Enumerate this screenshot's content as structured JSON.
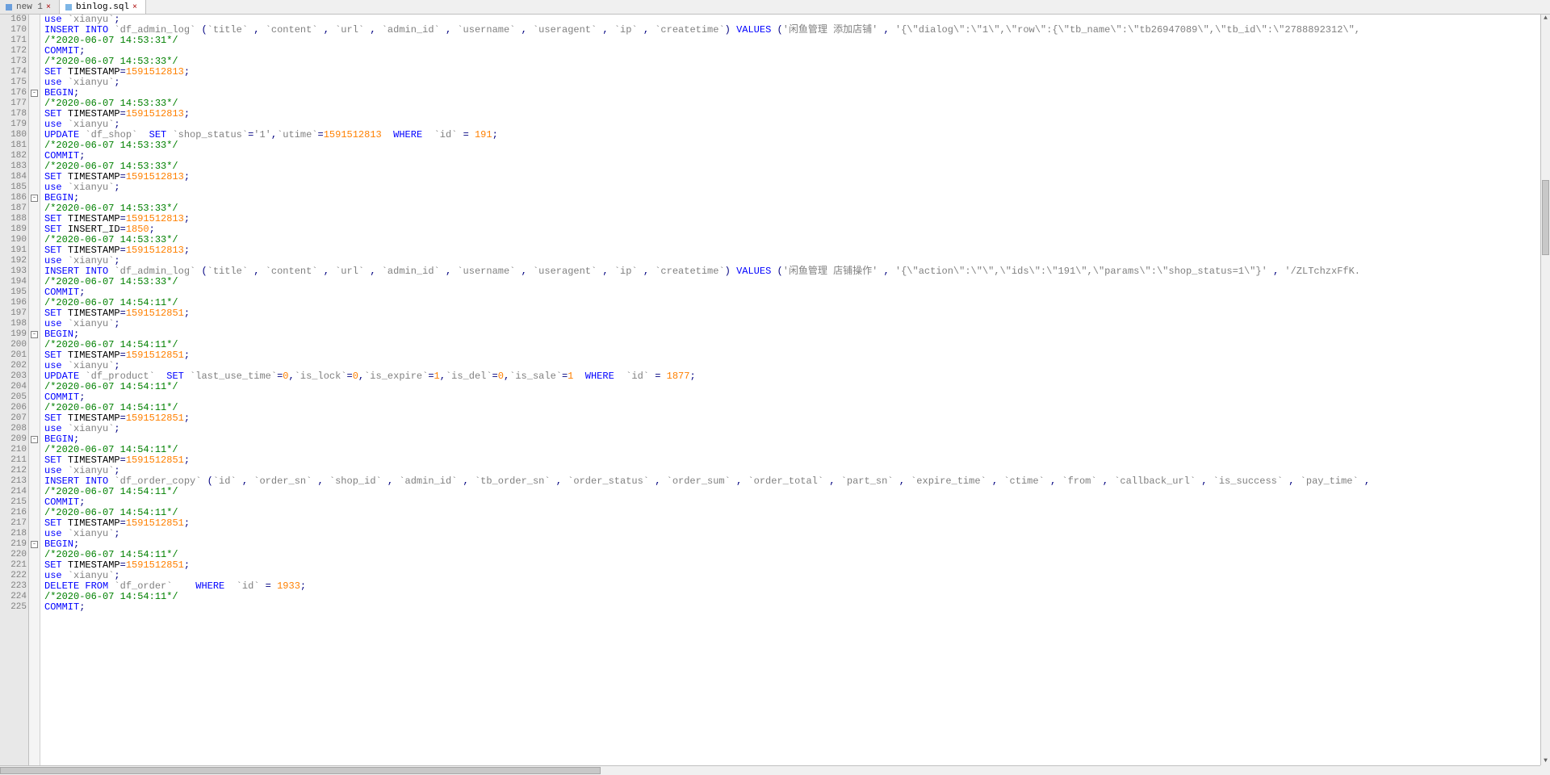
{
  "tabs": [
    {
      "label": "new 1",
      "active": false,
      "icon": "new"
    },
    {
      "label": "binlog.sql",
      "active": true,
      "icon": "sql"
    }
  ],
  "first_line": 169,
  "fold_lines": [
    176,
    186,
    199,
    209,
    219
  ],
  "scroll": {
    "v_thumb_top_pct": 22,
    "v_thumb_h_pct": 10,
    "h_thumb_left_pct": 0,
    "h_thumb_w_pct": 39
  },
  "lines": [
    [
      [
        "kw",
        "use "
      ],
      [
        "id",
        "`xianyu`"
      ],
      [
        "pun",
        ";"
      ]
    ],
    [
      [
        "kw",
        "INSERT INTO "
      ],
      [
        "id",
        "`df_admin_log`"
      ],
      [
        "pun",
        " ("
      ],
      [
        "id",
        "`title`"
      ],
      [
        "pun",
        " , "
      ],
      [
        "id",
        "`content`"
      ],
      [
        "pun",
        " , "
      ],
      [
        "id",
        "`url`"
      ],
      [
        "pun",
        " , "
      ],
      [
        "id",
        "`admin_id`"
      ],
      [
        "pun",
        " , "
      ],
      [
        "id",
        "`username`"
      ],
      [
        "pun",
        " , "
      ],
      [
        "id",
        "`useragent`"
      ],
      [
        "pun",
        " , "
      ],
      [
        "id",
        "`ip`"
      ],
      [
        "pun",
        " , "
      ],
      [
        "id",
        "`createtime`"
      ],
      [
        "pun",
        ") "
      ],
      [
        "kw",
        "VALUES"
      ],
      [
        "pun",
        " ("
      ],
      [
        "str",
        "'闲鱼管理 添加店铺'"
      ],
      [
        "pun",
        " , "
      ],
      [
        "str",
        "'{\\\"dialog\\\":\\\"1\\\",\\\"row\\\":{\\\"tb_name\\\":\\\"tb26947089\\\",\\\"tb_id\\\":\\\"2788892312\\\","
      ]
    ],
    [
      [
        "cmt",
        "/*2020-06-07 14:53:31*/"
      ]
    ],
    [
      [
        "kw",
        "COMMIT"
      ],
      [
        "pun",
        ";"
      ]
    ],
    [
      [
        "cmt",
        "/*2020-06-07 14:53:33*/"
      ]
    ],
    [
      [
        "kw",
        "SET "
      ],
      [
        "",
        "TIMESTAMP"
      ],
      [
        "pun",
        "="
      ],
      [
        "num",
        "1591512813"
      ],
      [
        "pun",
        ";"
      ]
    ],
    [
      [
        "kw",
        "use "
      ],
      [
        "id",
        "`xianyu`"
      ],
      [
        "pun",
        ";"
      ]
    ],
    [
      [
        "kw",
        "BEGIN"
      ],
      [
        "pun",
        ";"
      ]
    ],
    [
      [
        "cmt",
        "/*2020-06-07 14:53:33*/"
      ]
    ],
    [
      [
        "kw",
        "SET "
      ],
      [
        "",
        "TIMESTAMP"
      ],
      [
        "pun",
        "="
      ],
      [
        "num",
        "1591512813"
      ],
      [
        "pun",
        ";"
      ]
    ],
    [
      [
        "kw",
        "use "
      ],
      [
        "id",
        "`xianyu`"
      ],
      [
        "pun",
        ";"
      ]
    ],
    [
      [
        "kw",
        "UPDATE "
      ],
      [
        "id",
        "`df_shop`"
      ],
      [
        "",
        "  "
      ],
      [
        "kw",
        "SET"
      ],
      [
        "",
        ""
      ],
      [
        "id",
        " `shop_status`"
      ],
      [
        "pun",
        "="
      ],
      [
        "str",
        "'1'"
      ],
      [
        "pun",
        ","
      ],
      [
        "id",
        "`utime`"
      ],
      [
        "pun",
        "="
      ],
      [
        "num",
        "1591512813"
      ],
      [
        "",
        "  "
      ],
      [
        "kw",
        "WHERE"
      ],
      [
        "",
        "  "
      ],
      [
        "id",
        "`id`"
      ],
      [
        "pun",
        " = "
      ],
      [
        "num",
        "191"
      ],
      [
        "pun",
        ";"
      ]
    ],
    [
      [
        "cmt",
        "/*2020-06-07 14:53:33*/"
      ]
    ],
    [
      [
        "kw",
        "COMMIT"
      ],
      [
        "pun",
        ";"
      ]
    ],
    [
      [
        "cmt",
        "/*2020-06-07 14:53:33*/"
      ]
    ],
    [
      [
        "kw",
        "SET "
      ],
      [
        "",
        "TIMESTAMP"
      ],
      [
        "pun",
        "="
      ],
      [
        "num",
        "1591512813"
      ],
      [
        "pun",
        ";"
      ]
    ],
    [
      [
        "kw",
        "use "
      ],
      [
        "id",
        "`xianyu`"
      ],
      [
        "pun",
        ";"
      ]
    ],
    [
      [
        "kw",
        "BEGIN"
      ],
      [
        "pun",
        ";"
      ]
    ],
    [
      [
        "cmt",
        "/*2020-06-07 14:53:33*/"
      ]
    ],
    [
      [
        "kw",
        "SET "
      ],
      [
        "",
        "TIMESTAMP"
      ],
      [
        "pun",
        "="
      ],
      [
        "num",
        "1591512813"
      ],
      [
        "pun",
        ";"
      ]
    ],
    [
      [
        "kw",
        "SET "
      ],
      [
        "",
        "INSERT_ID"
      ],
      [
        "pun",
        "="
      ],
      [
        "num",
        "1850"
      ],
      [
        "pun",
        ";"
      ]
    ],
    [
      [
        "cmt",
        "/*2020-06-07 14:53:33*/"
      ]
    ],
    [
      [
        "kw",
        "SET "
      ],
      [
        "",
        "TIMESTAMP"
      ],
      [
        "pun",
        "="
      ],
      [
        "num",
        "1591512813"
      ],
      [
        "pun",
        ";"
      ]
    ],
    [
      [
        "kw",
        "use "
      ],
      [
        "id",
        "`xianyu`"
      ],
      [
        "pun",
        ";"
      ]
    ],
    [
      [
        "kw",
        "INSERT INTO "
      ],
      [
        "id",
        "`df_admin_log`"
      ],
      [
        "pun",
        " ("
      ],
      [
        "id",
        "`title`"
      ],
      [
        "pun",
        " , "
      ],
      [
        "id",
        "`content`"
      ],
      [
        "pun",
        " , "
      ],
      [
        "id",
        "`url`"
      ],
      [
        "pun",
        " , "
      ],
      [
        "id",
        "`admin_id`"
      ],
      [
        "pun",
        " , "
      ],
      [
        "id",
        "`username`"
      ],
      [
        "pun",
        " , "
      ],
      [
        "id",
        "`useragent`"
      ],
      [
        "pun",
        " , "
      ],
      [
        "id",
        "`ip`"
      ],
      [
        "pun",
        " , "
      ],
      [
        "id",
        "`createtime`"
      ],
      [
        "pun",
        ") "
      ],
      [
        "kw",
        "VALUES"
      ],
      [
        "pun",
        " ("
      ],
      [
        "str",
        "'闲鱼管理 店铺操作'"
      ],
      [
        "pun",
        " , "
      ],
      [
        "str",
        "'{\\\"action\\\":\\\"\\\",\\\"ids\\\":\\\"191\\\",\\\"params\\\":\\\"shop_status=1\\\"}'"
      ],
      [
        "pun",
        " , "
      ],
      [
        "str",
        "'/ZLTchzxFfK."
      ]
    ],
    [
      [
        "cmt",
        "/*2020-06-07 14:53:33*/"
      ]
    ],
    [
      [
        "kw",
        "COMMIT"
      ],
      [
        "pun",
        ";"
      ]
    ],
    [
      [
        "cmt",
        "/*2020-06-07 14:54:11*/"
      ]
    ],
    [
      [
        "kw",
        "SET "
      ],
      [
        "",
        "TIMESTAMP"
      ],
      [
        "pun",
        "="
      ],
      [
        "num",
        "1591512851"
      ],
      [
        "pun",
        ";"
      ]
    ],
    [
      [
        "kw",
        "use "
      ],
      [
        "id",
        "`xianyu`"
      ],
      [
        "pun",
        ";"
      ]
    ],
    [
      [
        "kw",
        "BEGIN"
      ],
      [
        "pun",
        ";"
      ]
    ],
    [
      [
        "cmt",
        "/*2020-06-07 14:54:11*/"
      ]
    ],
    [
      [
        "kw",
        "SET "
      ],
      [
        "",
        "TIMESTAMP"
      ],
      [
        "pun",
        "="
      ],
      [
        "num",
        "1591512851"
      ],
      [
        "pun",
        ";"
      ]
    ],
    [
      [
        "kw",
        "use "
      ],
      [
        "id",
        "`xianyu`"
      ],
      [
        "pun",
        ";"
      ]
    ],
    [
      [
        "kw",
        "UPDATE "
      ],
      [
        "id",
        "`df_product`"
      ],
      [
        "",
        "  "
      ],
      [
        "kw",
        "SET"
      ],
      [
        "",
        ""
      ],
      [
        "id",
        " `last_use_time`"
      ],
      [
        "pun",
        "="
      ],
      [
        "num",
        "0"
      ],
      [
        "pun",
        ","
      ],
      [
        "id",
        "`is_lock`"
      ],
      [
        "pun",
        "="
      ],
      [
        "num",
        "0"
      ],
      [
        "pun",
        ","
      ],
      [
        "id",
        "`is_expire`"
      ],
      [
        "pun",
        "="
      ],
      [
        "num",
        "1"
      ],
      [
        "pun",
        ","
      ],
      [
        "id",
        "`is_del`"
      ],
      [
        "pun",
        "="
      ],
      [
        "num",
        "0"
      ],
      [
        "pun",
        ","
      ],
      [
        "id",
        "`is_sale`"
      ],
      [
        "pun",
        "="
      ],
      [
        "num",
        "1"
      ],
      [
        "",
        "  "
      ],
      [
        "kw",
        "WHERE"
      ],
      [
        "",
        "  "
      ],
      [
        "id",
        "`id`"
      ],
      [
        "pun",
        " = "
      ],
      [
        "num",
        "1877"
      ],
      [
        "pun",
        ";"
      ]
    ],
    [
      [
        "cmt",
        "/*2020-06-07 14:54:11*/"
      ]
    ],
    [
      [
        "kw",
        "COMMIT"
      ],
      [
        "pun",
        ";"
      ]
    ],
    [
      [
        "cmt",
        "/*2020-06-07 14:54:11*/"
      ]
    ],
    [
      [
        "kw",
        "SET "
      ],
      [
        "",
        "TIMESTAMP"
      ],
      [
        "pun",
        "="
      ],
      [
        "num",
        "1591512851"
      ],
      [
        "pun",
        ";"
      ]
    ],
    [
      [
        "kw",
        "use "
      ],
      [
        "id",
        "`xianyu`"
      ],
      [
        "pun",
        ";"
      ]
    ],
    [
      [
        "kw",
        "BEGIN"
      ],
      [
        "pun",
        ";"
      ]
    ],
    [
      [
        "cmt",
        "/*2020-06-07 14:54:11*/"
      ]
    ],
    [
      [
        "kw",
        "SET "
      ],
      [
        "",
        "TIMESTAMP"
      ],
      [
        "pun",
        "="
      ],
      [
        "num",
        "1591512851"
      ],
      [
        "pun",
        ";"
      ]
    ],
    [
      [
        "kw",
        "use "
      ],
      [
        "id",
        "`xianyu`"
      ],
      [
        "pun",
        ";"
      ]
    ],
    [
      [
        "kw",
        "INSERT INTO "
      ],
      [
        "id",
        "`df_order_copy`"
      ],
      [
        "pun",
        " ("
      ],
      [
        "id",
        "`id`"
      ],
      [
        "pun",
        " , "
      ],
      [
        "id",
        "`order_sn`"
      ],
      [
        "pun",
        " , "
      ],
      [
        "id",
        "`shop_id`"
      ],
      [
        "pun",
        " , "
      ],
      [
        "id",
        "`admin_id`"
      ],
      [
        "pun",
        " , "
      ],
      [
        "id",
        "`tb_order_sn`"
      ],
      [
        "pun",
        " , "
      ],
      [
        "id",
        "`order_status`"
      ],
      [
        "pun",
        " , "
      ],
      [
        "id",
        "`order_sum`"
      ],
      [
        "pun",
        " , "
      ],
      [
        "id",
        "`order_total`"
      ],
      [
        "pun",
        " , "
      ],
      [
        "id",
        "`part_sn`"
      ],
      [
        "pun",
        " , "
      ],
      [
        "id",
        "`expire_time`"
      ],
      [
        "pun",
        " , "
      ],
      [
        "id",
        "`ctime`"
      ],
      [
        "pun",
        " , "
      ],
      [
        "id",
        "`from`"
      ],
      [
        "pun",
        " , "
      ],
      [
        "id",
        "`callback_url`"
      ],
      [
        "pun",
        " , "
      ],
      [
        "id",
        "`is_success`"
      ],
      [
        "pun",
        " , "
      ],
      [
        "id",
        "`pay_time`"
      ],
      [
        "pun",
        " ,"
      ]
    ],
    [
      [
        "cmt",
        "/*2020-06-07 14:54:11*/"
      ]
    ],
    [
      [
        "kw",
        "COMMIT"
      ],
      [
        "pun",
        ";"
      ]
    ],
    [
      [
        "cmt",
        "/*2020-06-07 14:54:11*/"
      ]
    ],
    [
      [
        "kw",
        "SET "
      ],
      [
        "",
        "TIMESTAMP"
      ],
      [
        "pun",
        "="
      ],
      [
        "num",
        "1591512851"
      ],
      [
        "pun",
        ";"
      ]
    ],
    [
      [
        "kw",
        "use "
      ],
      [
        "id",
        "`xianyu`"
      ],
      [
        "pun",
        ";"
      ]
    ],
    [
      [
        "kw",
        "BEGIN"
      ],
      [
        "pun",
        ";"
      ]
    ],
    [
      [
        "cmt",
        "/*2020-06-07 14:54:11*/"
      ]
    ],
    [
      [
        "kw",
        "SET "
      ],
      [
        "",
        "TIMESTAMP"
      ],
      [
        "pun",
        "="
      ],
      [
        "num",
        "1591512851"
      ],
      [
        "pun",
        ";"
      ]
    ],
    [
      [
        "kw",
        "use "
      ],
      [
        "id",
        "`xianyu`"
      ],
      [
        "pun",
        ";"
      ]
    ],
    [
      [
        "kw",
        "DELETE FROM "
      ],
      [
        "id",
        "`df_order`"
      ],
      [
        "",
        "    "
      ],
      [
        "kw",
        "WHERE"
      ],
      [
        "",
        "  "
      ],
      [
        "id",
        "`id`"
      ],
      [
        "pun",
        " = "
      ],
      [
        "num",
        "1933"
      ],
      [
        "pun",
        ";"
      ]
    ],
    [
      [
        "cmt",
        "/*2020-06-07 14:54:11*/"
      ]
    ],
    [
      [
        "kw",
        "COMMIT"
      ],
      [
        "pun",
        ";"
      ]
    ]
  ]
}
